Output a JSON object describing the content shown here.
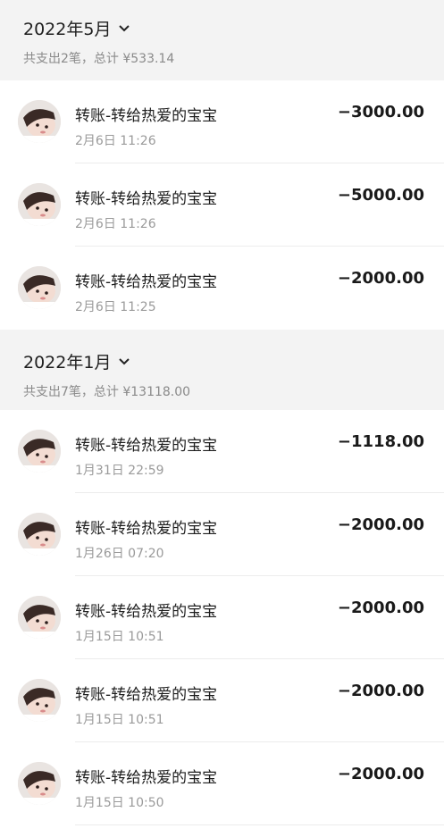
{
  "groups": [
    {
      "month": "2022年5月",
      "summary": "共支出2笔，总计 ¥533.14",
      "items": [
        {
          "title": "转账-转给热爱的宝宝",
          "time": "2月6日 11:26",
          "amount": "−3000.00"
        },
        {
          "title": "转账-转给热爱的宝宝",
          "time": "2月6日 11:26",
          "amount": "−5000.00"
        },
        {
          "title": "转账-转给热爱的宝宝",
          "time": "2月6日 11:25",
          "amount": "−2000.00"
        }
      ]
    },
    {
      "month": "2022年1月",
      "summary": "共支出7笔，总计 ¥13118.00",
      "items": [
        {
          "title": "转账-转给热爱的宝宝",
          "time": "1月31日 22:59",
          "amount": "−1118.00"
        },
        {
          "title": "转账-转给热爱的宝宝",
          "time": "1月26日 07:20",
          "amount": "−2000.00"
        },
        {
          "title": "转账-转给热爱的宝宝",
          "time": "1月15日 10:51",
          "amount": "−2000.00"
        },
        {
          "title": "转账-转给热爱的宝宝",
          "time": "1月15日 10:51",
          "amount": "−2000.00"
        },
        {
          "title": "转账-转给热爱的宝宝",
          "time": "1月15日 10:50",
          "amount": "−2000.00"
        }
      ]
    }
  ]
}
